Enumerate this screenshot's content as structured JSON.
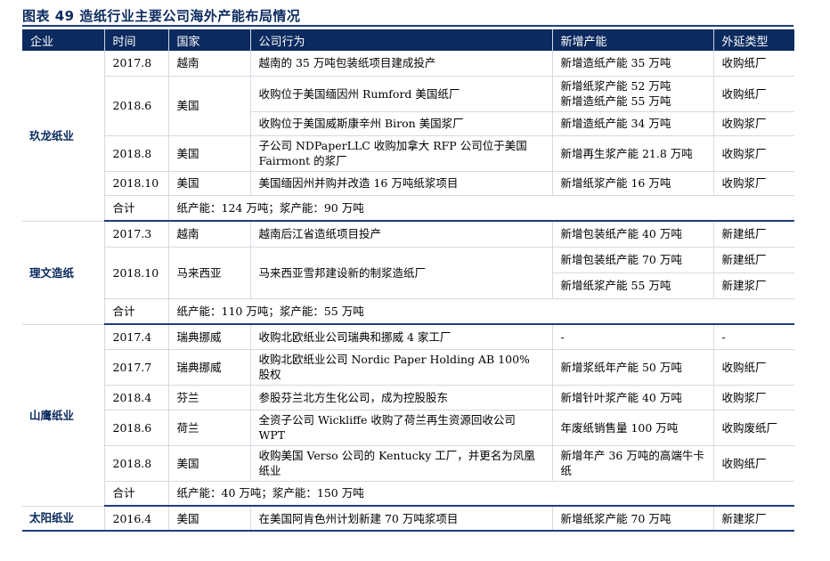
{
  "title": "图表 49   造纸行业主要公司海外产能布局情况",
  "headers": [
    "企业",
    "时间",
    "国家",
    "公司行为",
    "新增产能",
    "外延类型"
  ],
  "groups": [
    {
      "company": "玖龙纸业",
      "rows": [
        {
          "time": "2017.8",
          "country": "越南",
          "action": "越南的 35 万吨包装纸项目建成投产",
          "capacity": "新增造纸产能 35 万吨",
          "type": "收购纸厂"
        },
        {
          "time": "2018.6",
          "country": "美国",
          "action": "收购位于美国缅因州 Rumford 美国纸厂",
          "capacity": "新增纸浆产能 52 万吨\n新增造纸产能 55 万吨",
          "type": "收购纸厂"
        },
        {
          "time": "",
          "country": "",
          "action": "收购位于美国威斯康辛州 Biron 美国浆厂",
          "capacity": "新增造纸产能 34 万吨",
          "type": "收购浆厂"
        },
        {
          "time": "2018.8",
          "country": "美国",
          "action": "子公司 NDPaperLLC 收购加拿大 RFP 公司位于美国 Fairmont 的浆厂",
          "capacity": "新增再生浆产能 21.8 万吨",
          "type": "收购浆厂"
        },
        {
          "time": "2018.10",
          "country": "美国",
          "action": "美国缅因州并购并改造 16 万吨纸浆项目",
          "capacity": "新增纸浆产能 16 万吨",
          "type": "收购浆厂"
        }
      ],
      "total_label": "合计",
      "total": "纸产能：124 万吨；浆产能：90 万吨"
    },
    {
      "company": "理文造纸",
      "rows": [
        {
          "time": "2017.3",
          "country": "越南",
          "action": "越南后江省造纸项目投产",
          "capacity": "新增包装纸产能 40 万吨",
          "type": "新建纸厂"
        },
        {
          "time": "2018.10",
          "country": "马来西亚",
          "action": "马来西亚雪邦建设新的制浆造纸厂",
          "capacity": "新增包装纸产能 70 万吨",
          "type": "新建纸厂"
        },
        {
          "time": "",
          "country": "",
          "action": "",
          "capacity": "新增纸浆产能 55 万吨",
          "type": "新建浆厂"
        }
      ],
      "total_label": "合计",
      "total": "纸产能：110 万吨；浆产能：55 万吨"
    },
    {
      "company": "山鹰纸业",
      "rows": [
        {
          "time": "2017.4",
          "country": "瑞典挪威",
          "action": "收购北欧纸业公司瑞典和挪威 4 家工厂",
          "capacity": "-",
          "type": "-"
        },
        {
          "time": "2017.7",
          "country": "瑞典挪威",
          "action": "收购北欧纸业公司 Nordic Paper Holding AB 100% 股权",
          "capacity": "新增浆纸年产能 50 万吨",
          "type": "收购纸厂"
        },
        {
          "time": "2018.4",
          "country": "芬兰",
          "action": "参股芬兰北方生化公司，成为控股股东",
          "capacity": "新增针叶浆产能 40 万吨",
          "type": "收购浆厂"
        },
        {
          "time": "2018.6",
          "country": "荷兰",
          "action": "全资子公司 Wickliffe 收购了荷兰再生资源回收公司 WPT",
          "capacity": "年废纸销售量 100 万吨",
          "type": "收购废纸厂"
        },
        {
          "time": "2018.8",
          "country": "美国",
          "action": "收购美国 Verso 公司的 Kentucky 工厂，并更名为凤凰纸业",
          "capacity": "新增年产 36 万吨的高端牛卡纸",
          "type": "收购纸厂"
        }
      ],
      "total_label": "合计",
      "total": "纸产能：40 万吨；浆产能：150 万吨"
    },
    {
      "company": "太阳纸业",
      "rows": [
        {
          "time": "2016.4",
          "country": "美国",
          "action": "在美国阿肯色州计划新建 70 万吨浆项目",
          "capacity": "新增纸浆产能 70 万吨",
          "type": "新建浆厂"
        }
      ]
    }
  ]
}
